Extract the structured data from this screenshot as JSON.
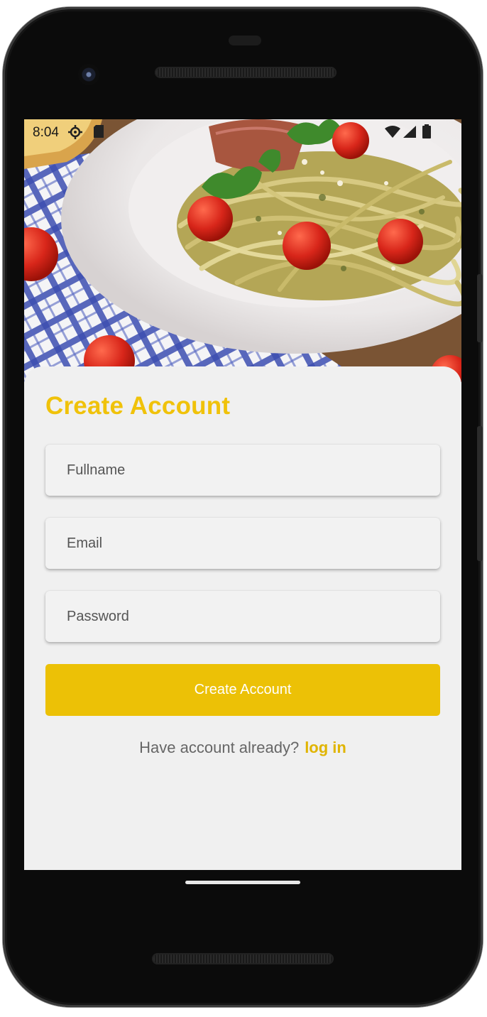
{
  "status_bar": {
    "time": "8:04",
    "icons": [
      "gear-icon",
      "sd-card-icon",
      "wifi-icon",
      "signal-icon",
      "battery-icon"
    ]
  },
  "hero": {
    "image": "pasta-with-tomatoes-photo"
  },
  "form": {
    "title": "Create Account",
    "fullname_placeholder": "Fullname",
    "email_placeholder": "Email",
    "password_placeholder": "Password",
    "submit_label": "Create Account",
    "footer_text": "Have account already?",
    "login_link": "log in"
  },
  "colors": {
    "accent": "#ecc106",
    "title": "#f0c20a",
    "sheet_background": "#f0f0f0"
  }
}
